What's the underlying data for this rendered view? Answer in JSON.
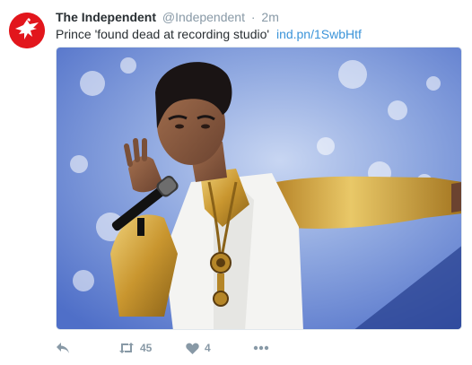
{
  "tweet": {
    "display_name": "The Independent",
    "handle": "@Independent",
    "separator": "·",
    "time": "2m",
    "text": "Prince 'found dead at recording studio'",
    "link": "ind.pn/1SwbHtf",
    "avatar_icon": "independent-eagle-logo",
    "brand_color": "#e2161c",
    "link_color": "#3b94d9",
    "muted_color": "#8899a6"
  },
  "actions": {
    "reply_icon": "reply-icon",
    "retweet_icon": "retweet-icon",
    "retweet_count": "45",
    "like_icon": "heart-icon",
    "like_count": "4",
    "more_icon": "more-dots-icon"
  }
}
